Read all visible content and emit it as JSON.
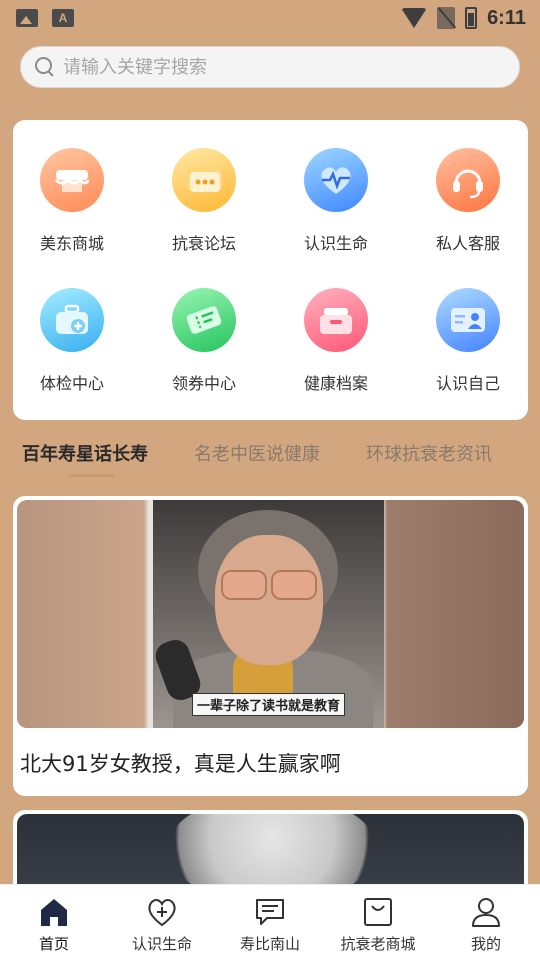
{
  "status_bar": {
    "time": "6:11"
  },
  "search": {
    "placeholder": "请输入关键字搜索"
  },
  "grid": [
    {
      "label": "美东商城",
      "icon": "shop-icon",
      "color_from": "#ffb48a",
      "color_to": "#ff8a55"
    },
    {
      "label": "抗衰论坛",
      "icon": "forum-icon",
      "color_from": "#ffe08a",
      "color_to": "#ffbe3a"
    },
    {
      "label": "认识生命",
      "icon": "heartbeat-icon",
      "color_from": "#8fd0ff",
      "color_to": "#4a90ff"
    },
    {
      "label": "私人客服",
      "icon": "headset-icon",
      "color_from": "#ffb28f",
      "color_to": "#ff7a45"
    },
    {
      "label": "体检中心",
      "icon": "medical-kit-icon",
      "color_from": "#8ce8ff",
      "color_to": "#3fb4f2"
    },
    {
      "label": "领券中心",
      "icon": "coupon-icon",
      "color_from": "#8ef0a8",
      "color_to": "#2fcf6a"
    },
    {
      "label": "健康档案",
      "icon": "archive-box-icon",
      "color_from": "#ffa3b0",
      "color_to": "#ff5f7a"
    },
    {
      "label": "认识自己",
      "icon": "id-card-icon",
      "color_from": "#9bd4ff",
      "color_to": "#4a8cff"
    }
  ],
  "tabs": [
    {
      "label": "百年寿星话长寿"
    },
    {
      "label": "名老中医说健康"
    },
    {
      "label": "环球抗衰老资讯"
    }
  ],
  "articles": [
    {
      "title": "北大91岁女教授，真是人生赢家啊",
      "caption": "一辈子除了读书就是教育"
    }
  ],
  "bottom_nav": [
    {
      "label": "首页",
      "icon": "home-icon"
    },
    {
      "label": "认识生命",
      "icon": "heart-plus-icon"
    },
    {
      "label": "寿比南山",
      "icon": "chat-icon"
    },
    {
      "label": "抗衰老商城",
      "icon": "shopping-bag-icon"
    },
    {
      "label": "我的",
      "icon": "user-icon"
    }
  ],
  "colors": {
    "background": "#d2a67f",
    "accent": "#1f2a44"
  }
}
